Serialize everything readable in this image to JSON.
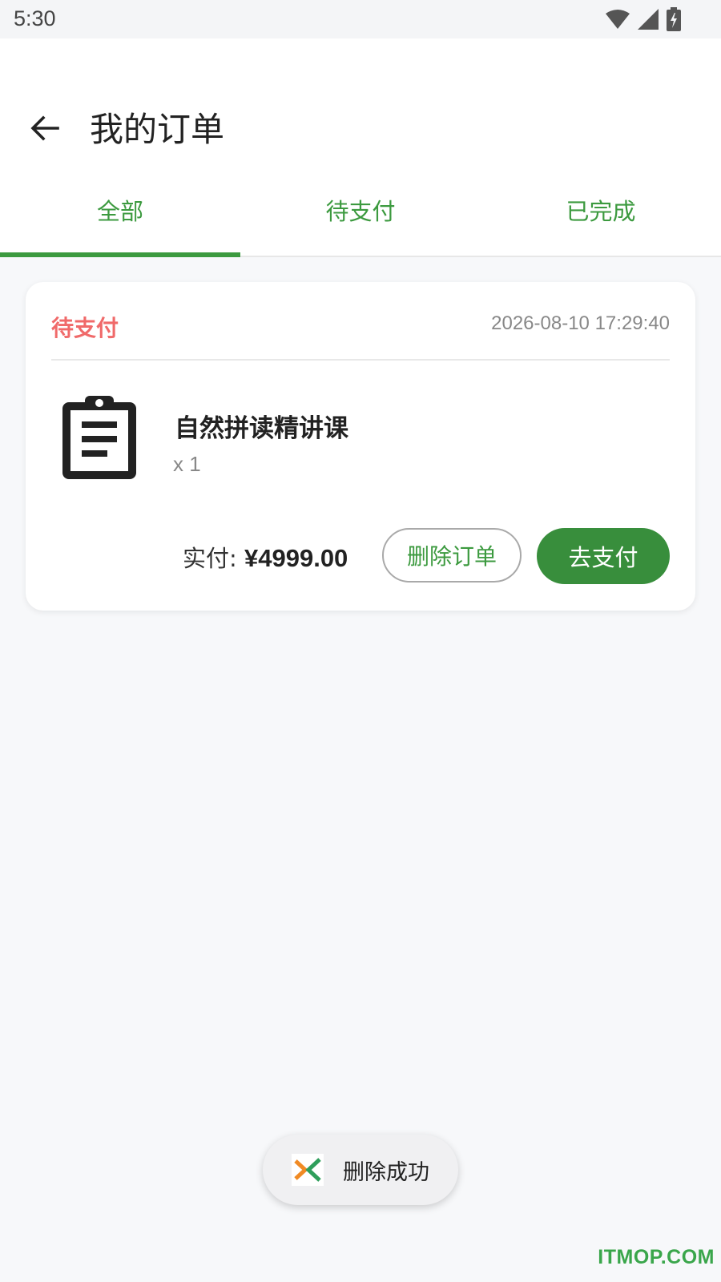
{
  "status_bar": {
    "time": "5:30",
    "icons": [
      "wifi-icon",
      "signal-icon",
      "battery-charging-icon"
    ]
  },
  "header": {
    "title": "我的订单",
    "back_icon": "arrow-left-icon"
  },
  "tabs": [
    {
      "label": "全部",
      "active": true
    },
    {
      "label": "待支付",
      "active": false
    },
    {
      "label": "已完成",
      "active": false
    }
  ],
  "orders": [
    {
      "status": "待支付",
      "time": "2026-08-10 17:29:40",
      "product_icon": "clipboard-icon",
      "product_name": "自然拼读精讲课",
      "quantity": "x 1",
      "price_label": "实付:",
      "price_value": "¥4999.00",
      "delete_label": "删除订单",
      "pay_label": "去支付"
    }
  ],
  "toast": {
    "icon": "app-logo-icon",
    "text": "删除成功"
  },
  "watermark": "ITMOP.COM",
  "colors": {
    "accent": "#3c9a3f",
    "pay_button": "#388e3c",
    "pending_status": "#f06a6a",
    "background": "#f7f8fa"
  }
}
